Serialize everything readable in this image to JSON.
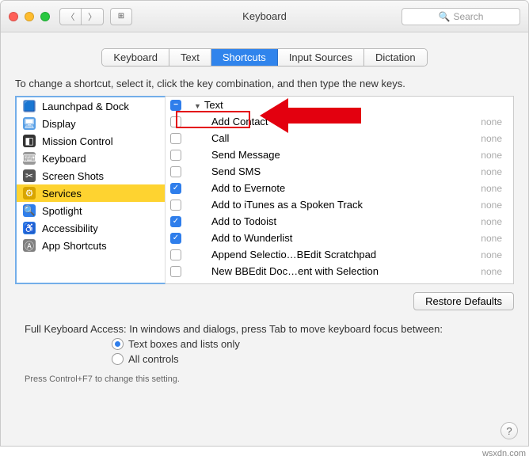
{
  "window": {
    "title": "Keyboard",
    "search_placeholder": "Search"
  },
  "tabs": [
    "Keyboard",
    "Text",
    "Shortcuts",
    "Input Sources",
    "Dictation"
  ],
  "instruction": "To change a shortcut, select it, click the key combination, and then type the new keys.",
  "categories": [
    {
      "name": "Launchpad & Dock",
      "icon": "🟦",
      "ic_bg": "#8aa9d6"
    },
    {
      "name": "Display",
      "icon": "🖥",
      "ic_bg": "#5aa0e6"
    },
    {
      "name": "Mission Control",
      "icon": "◧",
      "ic_bg": "#333"
    },
    {
      "name": "Keyboard",
      "icon": "⌨",
      "ic_bg": "#999"
    },
    {
      "name": "Screen Shots",
      "icon": "✂",
      "ic_bg": "#555"
    },
    {
      "name": "Services",
      "icon": "⚙",
      "ic_bg": "#d8a500"
    },
    {
      "name": "Spotlight",
      "icon": "🔍",
      "ic_bg": "#2f7eeb"
    },
    {
      "name": "Accessibility",
      "icon": "♿",
      "ic_bg": "#2f7eeb"
    },
    {
      "name": "App Shortcuts",
      "icon": "Ⓐ",
      "ic_bg": "#808080"
    }
  ],
  "selected_category": "Services",
  "group_header": "Text",
  "services": [
    {
      "label": "Add Contact",
      "short": "none",
      "checked": false
    },
    {
      "label": "Call",
      "short": "none",
      "checked": false
    },
    {
      "label": "Send Message",
      "short": "none",
      "checked": false
    },
    {
      "label": "Send SMS",
      "short": "none",
      "checked": false
    },
    {
      "label": "Add to Evernote",
      "short": "none",
      "checked": true
    },
    {
      "label": "Add to iTunes as a Spoken Track",
      "short": "none",
      "checked": false
    },
    {
      "label": "Add to Todoist",
      "short": "none",
      "checked": true
    },
    {
      "label": "Add to Wunderlist",
      "short": "none",
      "checked": true
    },
    {
      "label": "Append Selectio…BEdit Scratchpad",
      "short": "none",
      "checked": false
    },
    {
      "label": "New BBEdit Doc…ent with Selection",
      "short": "none",
      "checked": false
    }
  ],
  "restore_label": "Restore Defaults",
  "fka": {
    "heading": "Full Keyboard Access: In windows and dialogs, press Tab to move keyboard focus between:",
    "opt1": "Text boxes and lists only",
    "opt2": "All controls",
    "selected": 0
  },
  "footnote": "Press Control+F7 to change this setting.",
  "watermark": "wsxdn.com"
}
